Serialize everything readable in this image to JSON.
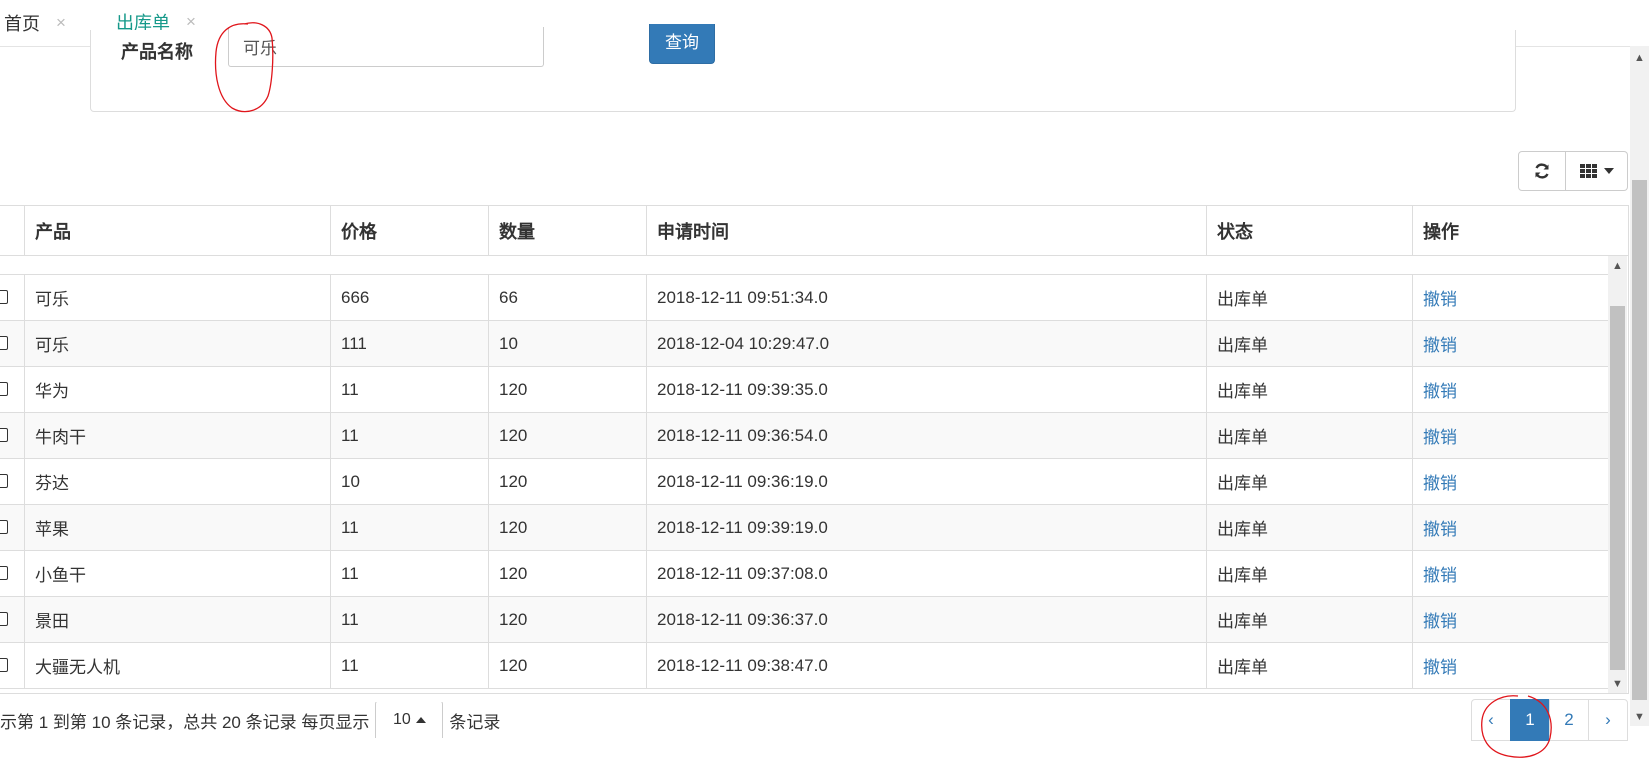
{
  "tabs": [
    {
      "label": "首页",
      "close": "×"
    },
    {
      "label": "出库单",
      "close": "×"
    }
  ],
  "search": {
    "label": "产品名称",
    "value": "可乐",
    "button": "查询"
  },
  "table": {
    "headers": [
      "产品",
      "价格",
      "数量",
      "申请时间",
      "状态",
      "操作"
    ],
    "rows": [
      {
        "product": "可乐",
        "price": "666",
        "qty": "66",
        "time": "2018-12-11 09:51:34.0",
        "status": "出库单",
        "action": "撤销"
      },
      {
        "product": "可乐",
        "price": "111",
        "qty": "10",
        "time": "2018-12-04 10:29:47.0",
        "status": "出库单",
        "action": "撤销"
      },
      {
        "product": "华为",
        "price": "11",
        "qty": "120",
        "time": "2018-12-11 09:39:35.0",
        "status": "出库单",
        "action": "撤销"
      },
      {
        "product": "牛肉干",
        "price": "11",
        "qty": "120",
        "time": "2018-12-11 09:36:54.0",
        "status": "出库单",
        "action": "撤销"
      },
      {
        "product": "芬达",
        "price": "10",
        "qty": "120",
        "time": "2018-12-11 09:36:19.0",
        "status": "出库单",
        "action": "撤销"
      },
      {
        "product": "苹果",
        "price": "11",
        "qty": "120",
        "time": "2018-12-11 09:39:19.0",
        "status": "出库单",
        "action": "撤销"
      },
      {
        "product": "小鱼干",
        "price": "11",
        "qty": "120",
        "time": "2018-12-11 09:37:08.0",
        "status": "出库单",
        "action": "撤销"
      },
      {
        "product": "景田",
        "price": "11",
        "qty": "120",
        "time": "2018-12-11 09:36:37.0",
        "status": "出库单",
        "action": "撤销"
      },
      {
        "product": "大疆无人机",
        "price": "11",
        "qty": "120",
        "time": "2018-12-11 09:38:47.0",
        "status": "出库单",
        "action": "撤销"
      }
    ]
  },
  "pagination": {
    "info_prefix": "示第 1 到第 10 条记录，总共 20 条记录 每页显示",
    "page_size": "10",
    "info_suffix": "条记录",
    "prev": "‹",
    "pages": [
      "1",
      "2"
    ],
    "next": "›",
    "current": "1"
  },
  "icons": {
    "refresh": "refresh-icon",
    "columns": "columns-grid-icon",
    "caret": "caret-down-icon",
    "scroll_up": "▲",
    "scroll_down": "▼"
  },
  "colors": {
    "accent_tab": "#16998a",
    "primary": "#337ab7",
    "annotation": "#e0151b"
  }
}
